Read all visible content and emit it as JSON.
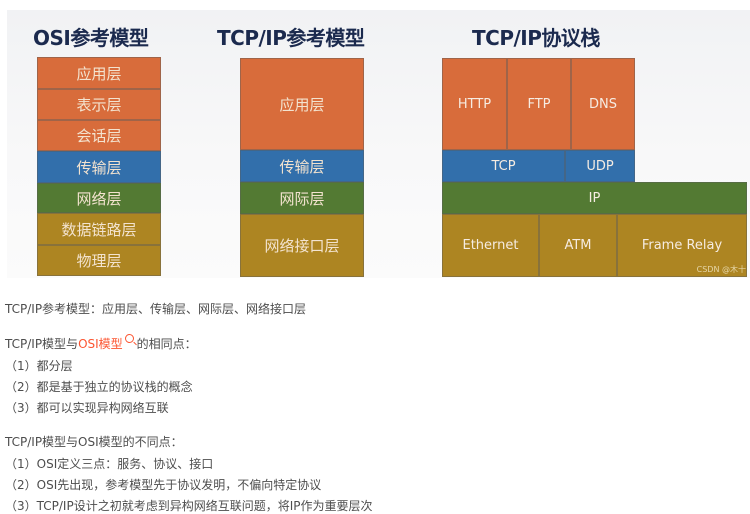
{
  "figure": {
    "titles": {
      "osi": "OSI参考模型",
      "tcpip_ref": "TCP/IP参考模型",
      "tcpip_stack": "TCP/IP协议栈"
    },
    "osi_layers": [
      "应用层",
      "表示层",
      "会话层",
      "传输层",
      "网络层",
      "数据链路层",
      "物理层"
    ],
    "tcpip_layers": [
      "应用层",
      "传输层",
      "网际层",
      "网络接口层"
    ],
    "stack": {
      "application": [
        "HTTP",
        "FTP",
        "DNS"
      ],
      "transport": [
        "TCP",
        "UDP"
      ],
      "internet": "IP",
      "link": [
        "Ethernet",
        "ATM",
        "Frame Relay"
      ]
    },
    "watermark": "CSDN @木十",
    "colors": {
      "application": "#d86c3b",
      "transport": "#326fab",
      "network": "#537a33",
      "link": "#ad8522"
    }
  },
  "article": {
    "line1": "TCP/IP参考模型：应用层、传输层、网际层、网络接口层",
    "same_prefix": "TCP/IP模型与",
    "same_link": "OSI模型",
    "same_suffix": "的相同点：",
    "same_points": [
      "（1）都分层",
      "（2）都是基于独立的协议栈的概念",
      "（3）都可以实现异构网络互联"
    ],
    "diff_heading": "TCP/IP模型与OSI模型的不同点：",
    "diff_points": [
      "（1）OSI定义三点：服务、协议、接口",
      "（2）OSI先出现，参考模型先于协议发明，不偏向特定协议",
      "（3）TCP/IP设计之初就考虑到异构网络互联问题，将IP作为重要层次"
    ]
  }
}
